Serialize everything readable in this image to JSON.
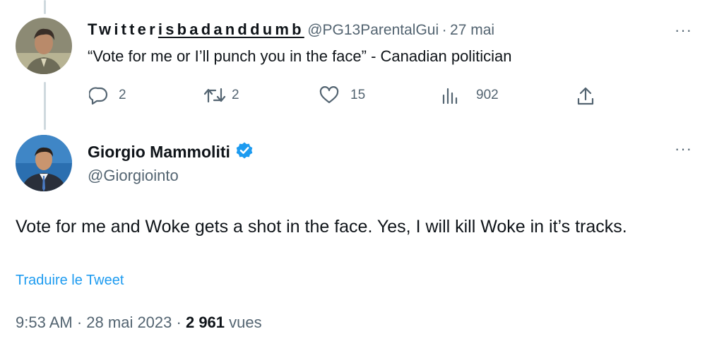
{
  "parent_tweet": {
    "display_name": "Twitterisbadanddumb",
    "handle": "@PG13ParentalGui",
    "separator": "·",
    "date": "27 mai",
    "text": "“Vote for me or I’ll punch you in the face” - Canadian politician",
    "more_label": "···",
    "actions": {
      "replies": "2",
      "retweets": "2",
      "likes": "15",
      "views": "902"
    }
  },
  "main_tweet": {
    "display_name": "Giorgio Mammoliti",
    "verified": true,
    "handle": "@Giorgiointo",
    "more_label": "···",
    "text": "Vote for me and Woke gets a shot in the face.   Yes,  I will kill Woke in it’s tracks.",
    "translate_label": "Traduire le Tweet",
    "time": "9:53 AM",
    "separator": "·",
    "date": "28 mai 2023",
    "views_count": "2 961",
    "views_label": "vues"
  },
  "colors": {
    "text_primary": "#0f1419",
    "text_secondary": "#536471",
    "link": "#1d9bf0",
    "verified_badge": "#1d9bf0",
    "thread_line": "#cfd9de"
  },
  "icons": [
    "reply-icon",
    "retweet-icon",
    "like-icon",
    "views-icon",
    "share-icon",
    "verified-badge-icon"
  ]
}
